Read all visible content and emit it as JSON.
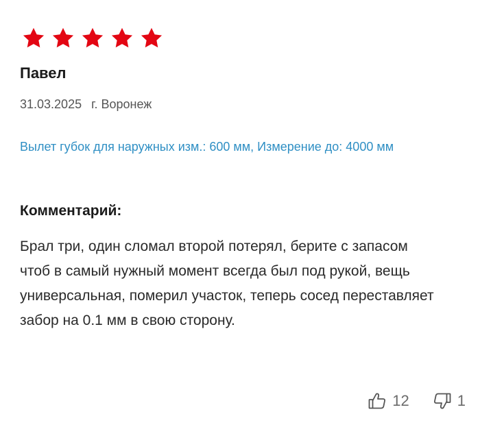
{
  "review": {
    "rating": 5,
    "star_color": "#e30613",
    "author": "Павел",
    "date": "31.03.2025",
    "city": "г. Воронеж",
    "variant": "Вылет губок для наружных изм.: 600 мм, Измерение до: 4000 мм",
    "variant_color": "#2f8fc4",
    "comment_heading": "Комментарий:",
    "comment_text": "Брал три, один сломал второй потерял, берите с запасом чтоб в самый нужный момент всегда был под рукой, вещь универсальная, померил участок, теперь сосед переставляет забор на 0.1 мм в свою сторону.",
    "votes": {
      "likes": "12",
      "like_icon": "thumbs-up-icon",
      "dislikes": "1",
      "dislike_icon": "thumbs-down-icon"
    }
  }
}
